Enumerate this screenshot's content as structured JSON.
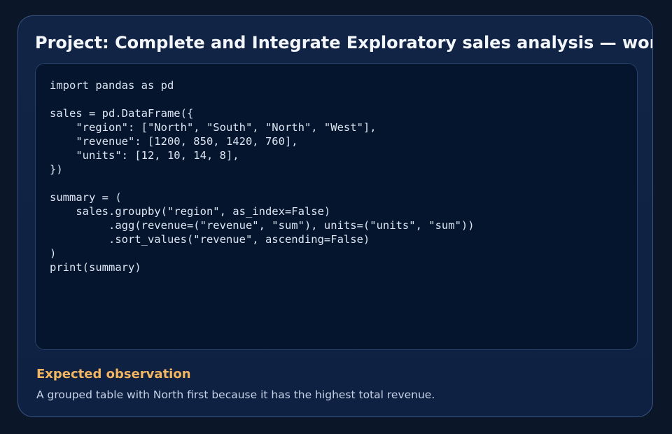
{
  "project": {
    "title": "Project: Complete and Integrate Exploratory sales analysis — worked example"
  },
  "code": {
    "language": "python",
    "source": "import pandas as pd\n\nsales = pd.DataFrame({\n    \"region\": [\"North\", \"South\", \"North\", \"West\"],\n    \"revenue\": [1200, 850, 1420, 760],\n    \"units\": [12, 10, 14, 8],\n})\n\nsummary = (\n    sales.groupby(\"region\", as_index=False)\n         .agg(revenue=(\"revenue\", \"sum\"), units=(\"units\", \"sum\"))\n         .sort_values(\"revenue\", ascending=False)\n)\nprint(summary)"
  },
  "observation": {
    "heading": "Expected observation",
    "text": "A grouped table with North first because it has the highest total revenue."
  },
  "colors": {
    "background": "#0b1628",
    "card": "#112446",
    "code_background": "#05152e",
    "accent": "#f2b661",
    "text": "#dce5f2"
  }
}
